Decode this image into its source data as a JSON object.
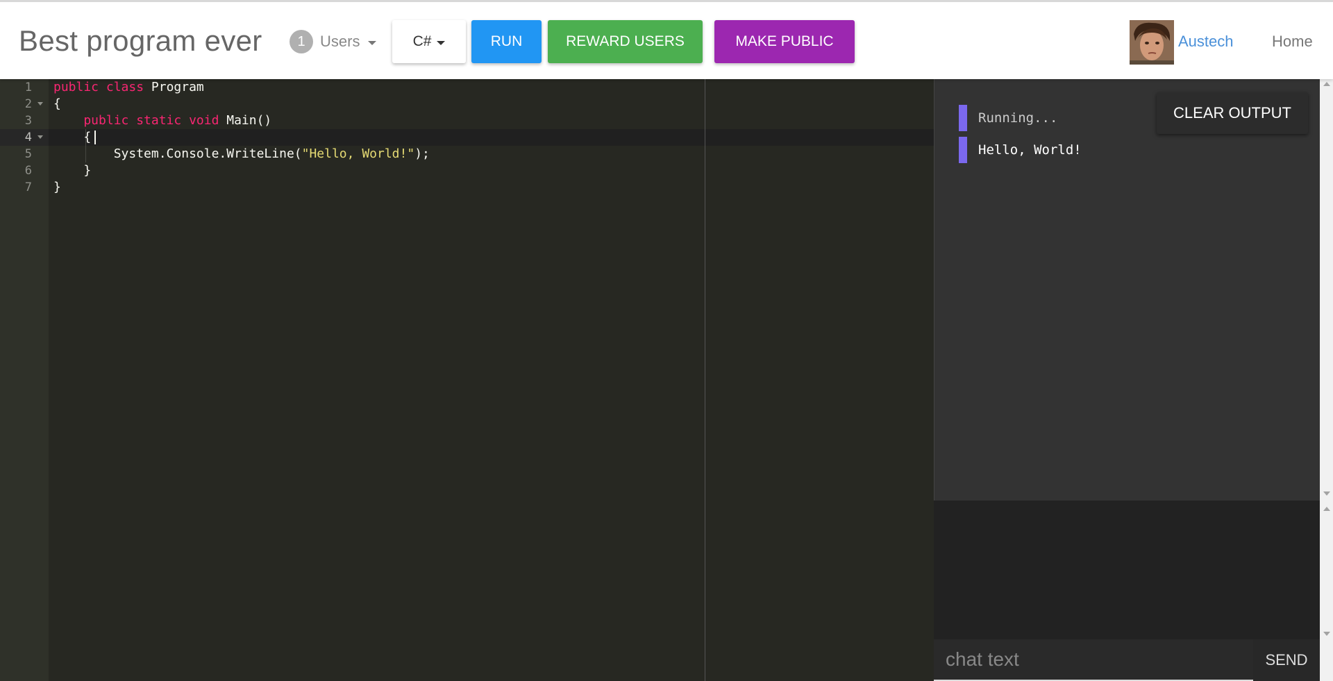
{
  "header": {
    "title": "Best program ever",
    "users": {
      "count": "1",
      "label": "Users"
    },
    "language": "C#",
    "run_label": "RUN",
    "reward_label": "REWARD USERS",
    "public_label": "MAKE PUBLIC",
    "username": "Austech",
    "home_label": "Home"
  },
  "editor": {
    "line_numbers": [
      "1",
      "2",
      "3",
      "4",
      "5",
      "6",
      "7"
    ],
    "active_line": "4",
    "lines": [
      [
        {
          "t": "public class ",
          "c": "kw"
        },
        {
          "t": "Program",
          "c": ""
        }
      ],
      [
        {
          "t": "{",
          "c": ""
        }
      ],
      [
        {
          "t": "    public static void ",
          "c": "kw"
        },
        {
          "t": "Main()",
          "c": ""
        }
      ],
      [
        {
          "t": "    {",
          "c": ""
        }
      ],
      [
        {
          "t": "        System.Console.WriteLine(",
          "c": ""
        },
        {
          "t": "\"Hello, World!\"",
          "c": "str"
        },
        {
          "t": ");",
          "c": ""
        }
      ],
      [
        {
          "t": "    }",
          "c": ""
        }
      ],
      [
        {
          "t": "}",
          "c": ""
        }
      ]
    ]
  },
  "output": {
    "lines": [
      "Running...",
      "Hello, World!"
    ],
    "clear_label": "CLEAR OUTPUT"
  },
  "chat": {
    "placeholder": "chat text",
    "send_label": "SEND"
  },
  "colors": {
    "run": "#2196f3",
    "reward": "#4caf50",
    "public": "#9c27b0",
    "output_marker": "#7b68ee",
    "username": "#4a90d9"
  }
}
